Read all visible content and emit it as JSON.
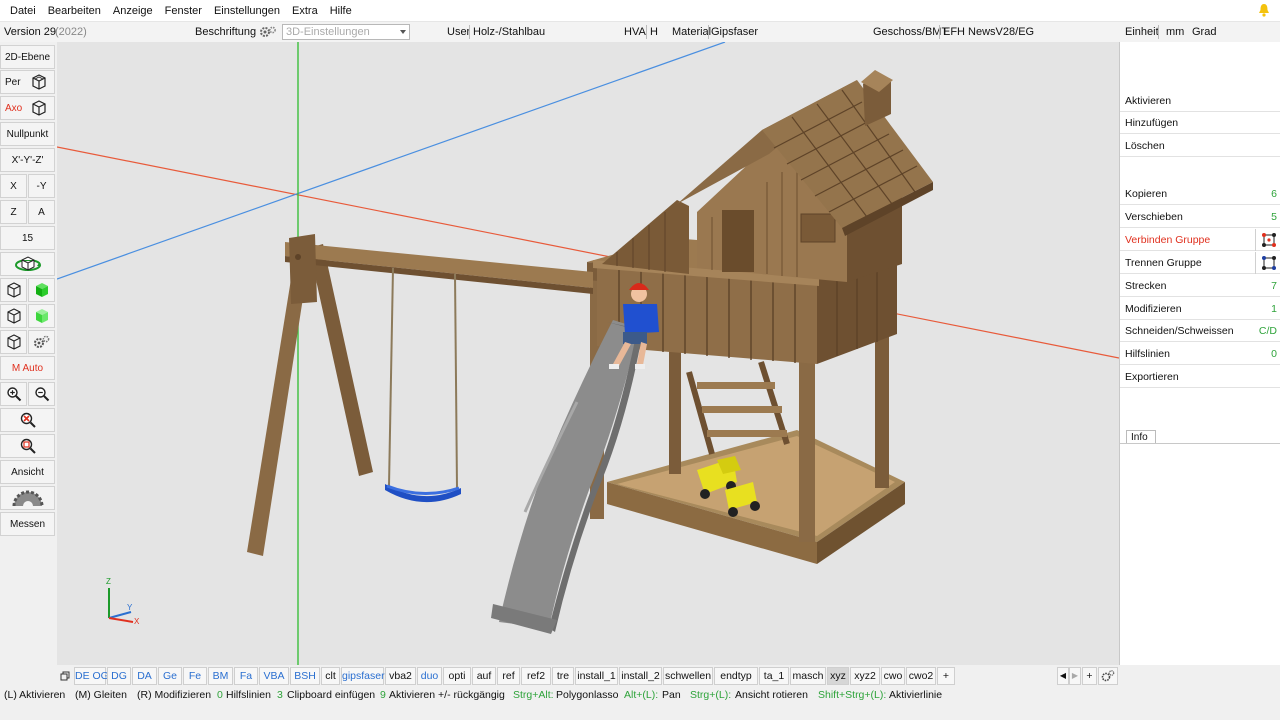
{
  "menu": [
    "Datei",
    "Bearbeiten",
    "Anzeige",
    "Fenster",
    "Einstellungen",
    "Extra",
    "Hilfe"
  ],
  "info": {
    "version": "Version 29",
    "year": "(2022)",
    "beschriftung": "Beschriftung",
    "settings3d": "3D-Einstellungen",
    "user_label": "User",
    "user_value": "Holz-/Stahlbau",
    "hva_label": "HVA",
    "hva_value": "H",
    "material_label": "Material",
    "material_value": "Gipsfaser",
    "geschoss_label": "Geschoss/BMT",
    "geschoss_value": "EFH NewsV28/EG",
    "einheit_label": "Einheit",
    "einheit_mm": "mm",
    "einheit_grad": "Grad"
  },
  "left": {
    "ebene2d": "2D-Ebene",
    "per": "Per",
    "axo": "Axo",
    "nullpunkt": "Nullpunkt",
    "xyz": "X'-Y'-Z'",
    "x": "X",
    "neg_y": "-Y",
    "z": "Z",
    "a": "A",
    "number": "15",
    "mauto": "M Auto",
    "ansicht": "Ansicht",
    "messen": "Messen"
  },
  "right": [
    {
      "label": "Aktivieren",
      "num": ""
    },
    {
      "label": "Hinzufügen",
      "num": ""
    },
    {
      "label": "Löschen",
      "num": ""
    },
    {
      "label": "Kopieren",
      "num": "6"
    },
    {
      "label": "Verschieben",
      "num": "5"
    },
    {
      "label": "Verbinden Gruppe",
      "num": ""
    },
    {
      "label": "Trennen Gruppe",
      "num": ""
    },
    {
      "label": "Strecken",
      "num": "7"
    },
    {
      "label": "Modifizieren",
      "num": "1"
    },
    {
      "label": "Schneiden/Schweissen",
      "num": "C/D"
    },
    {
      "label": "Hilfslinien",
      "num": "0"
    },
    {
      "label": "Exportieren",
      "num": ""
    }
  ],
  "info_tab": "Info",
  "tabs": [
    "DE OG",
    "DG",
    "DA",
    "Ge",
    "Fe",
    "BM",
    "Fa",
    "VBA",
    "BSH",
    "clt",
    "gipsfaser",
    "vba2",
    "duo",
    "opti",
    "auf",
    "ref",
    "ref2",
    "tre",
    "install_1",
    "install_2",
    "schwellen",
    "endtyp",
    "ta_1",
    "masch",
    "xyz",
    "xyz2",
    "cwo",
    "cwo2",
    "+"
  ],
  "tab_nav": "+",
  "status": {
    "s1": "(L) Aktivieren",
    "s2": "(M) Gleiten",
    "s3": "(R) Modifizieren",
    "s4k": "0",
    "s4": "Hilfslinien",
    "s5k": "3",
    "s5": "Clipboard einfügen",
    "s6k": "9",
    "s6": "Aktivieren +/- rückgängig",
    "s7k": "Strg+Alt:",
    "s7": "Polygonlasso",
    "s8k": "Alt+(L):",
    "s8": "Pan",
    "s9k": "Strg+(L):",
    "s9": "Ansicht rotieren",
    "s10k": "Shift+Strg+(L):",
    "s10": "Aktivierlinie"
  },
  "axis": {
    "z": "Z",
    "y": "Y",
    "x": "X"
  },
  "colors": {
    "accent_red": "#e0301e",
    "accent_green": "#2ea33a",
    "accent_blue": "#2a6fd0",
    "wood": "#8a6a45",
    "wood_dark": "#5e4328",
    "slide": "#8c8c8c",
    "swing_seat": "#1f4fc4",
    "toy_truck": "#e8e020"
  },
  "icons": [
    "bell-icon",
    "gear-icon",
    "chevron-down-icon",
    "perspective-cube-icon",
    "axo-cube-icon",
    "rotate-view-icon",
    "wire-cube-icon",
    "green-cube-icon",
    "zoom-in-icon",
    "zoom-out-icon",
    "zoom-reset-icon",
    "zoom-window-icon",
    "half-gear-icon",
    "connect-group-icon",
    "split-group-icon"
  ]
}
